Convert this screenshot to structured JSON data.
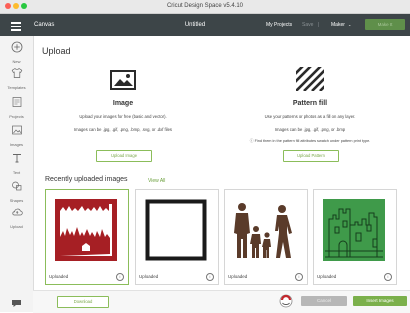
{
  "window": {
    "title": "Cricut Design Space  v5.4.10"
  },
  "header": {
    "app_name": "Canvas",
    "project_title": "Untitled",
    "my_projects": "My Projects",
    "save": "Save",
    "separator": "|",
    "machine": "Maker",
    "make_it": "Make It"
  },
  "sidebar": {
    "items": [
      {
        "label": "New"
      },
      {
        "label": "Templates"
      },
      {
        "label": "Projects"
      },
      {
        "label": "Images"
      },
      {
        "label": "Text"
      },
      {
        "label": "Shapes"
      },
      {
        "label": "Upload"
      }
    ]
  },
  "main": {
    "title": "Upload",
    "image_card": {
      "title": "Image",
      "line1": "Upload your images for free (basic and vector).",
      "line2": "Images can be .jpg, .gif, .png, .bmp, .svg, or .dxf files",
      "button": "Upload Image"
    },
    "pattern_card": {
      "title": "Pattern fill",
      "line1": "Use your patterns or photos as a fill on any layer.",
      "line2": "Images can be .jpg, .gif, .png, or .bmp",
      "note": "ⓘ Find them in the pattern fill attributes swatch under pattern print type.",
      "button": "Upload Pattern"
    },
    "recent_title": "Recently uploaded images",
    "view_all": "View All",
    "thumbnails": [
      {
        "status": "Uploaded",
        "image": "red-forest-frame"
      },
      {
        "status": "Uploaded",
        "image": "black-square-frame"
      },
      {
        "status": "Uploaded",
        "image": "family-silhouette"
      },
      {
        "status": "Uploaded",
        "image": "green-castle"
      }
    ]
  },
  "footer": {
    "download": "Download",
    "cancel": "Cancel",
    "insert": "Insert Images"
  },
  "colors": {
    "accent": "#8bbd5a",
    "header": "#3d4548",
    "thumb_red": "#a61f24",
    "thumb_brown": "#5a3b2a",
    "thumb_green": "#3f9a4a"
  }
}
